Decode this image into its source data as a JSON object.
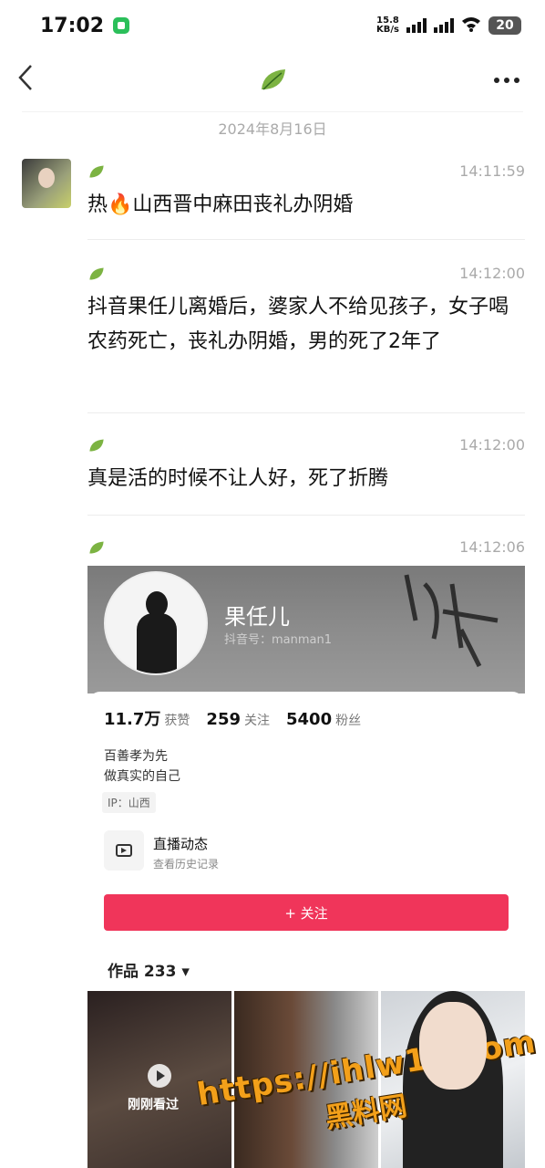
{
  "status_bar": {
    "time": "17:02",
    "net_speed_value": "15.8",
    "net_speed_unit": "KB/s",
    "battery": "20"
  },
  "nav": {
    "back_icon": "chevron-left",
    "title_icon": "leaf-icon",
    "more_icon": "more-dots"
  },
  "date_divider": "2024年8月16日",
  "messages": [
    {
      "time": "14:11:59",
      "text": "热🔥山西晋中麻田丧礼办阴婚"
    },
    {
      "time": "14:12:00",
      "text": "抖音果任儿离婚后，婆家人不给见孩子，女子喝农药死亡，丧礼办阴婚，男的死了2年了"
    },
    {
      "time": "14:12:00",
      "text": "真是活的时候不让人好，死了折腾"
    },
    {
      "time": "14:12:06",
      "text": ""
    }
  ],
  "profile_card": {
    "name": "果任儿",
    "id_text": "抖音号：manman1",
    "likes": "11.7万",
    "likes_label": "获赞",
    "following": "259",
    "following_label": "关注",
    "fans": "5400",
    "fans_label": "粉丝",
    "bio_line1": "百善孝为先",
    "bio_line2": "做真实的自己",
    "ip": "IP：山西",
    "live_title": "直播动态",
    "live_sub": "查看历史记录",
    "follow_button": "+ 关注",
    "works_label": "作品 233 ▾",
    "tile1_overlay": "刚刚看过"
  },
  "watermark": {
    "url": "https://ihlw19.com",
    "cn": "黑料网"
  },
  "colors": {
    "follow_button": "#f0355a",
    "watermark": "#f3a01a"
  }
}
